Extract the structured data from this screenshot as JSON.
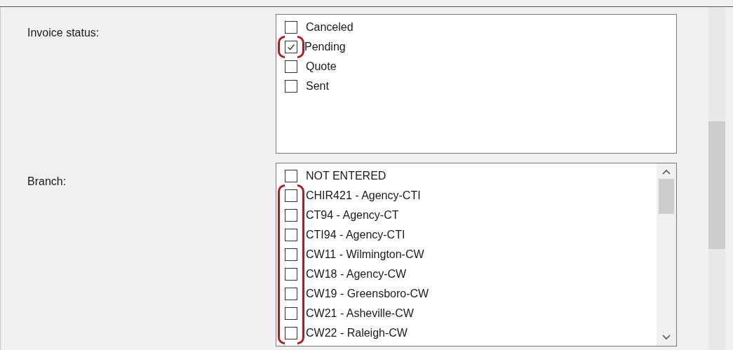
{
  "fields": [
    {
      "label": "Invoice status:",
      "kind": "plain",
      "options": [
        {
          "label": "Canceled",
          "checked": false,
          "circled": false
        },
        {
          "label": "Pending",
          "checked": true,
          "circled": true
        },
        {
          "label": "Quote",
          "checked": false,
          "circled": false
        },
        {
          "label": "Sent",
          "checked": false,
          "circled": false
        }
      ]
    },
    {
      "label": "Branch:",
      "kind": "scrolling",
      "options": [
        {
          "label": "NOT ENTERED",
          "checked": false,
          "circled": false
        },
        {
          "label": "CHIR421 - Agency-CTI",
          "checked": false,
          "circled": true
        },
        {
          "label": "CT94 - Agency-CT",
          "checked": false,
          "circled": true
        },
        {
          "label": "CTI94 - Agency-CTI",
          "checked": false,
          "circled": true
        },
        {
          "label": "CW11 - Wilmington-CW",
          "checked": false,
          "circled": true
        },
        {
          "label": "CW18 - Agency-CW",
          "checked": false,
          "circled": true
        },
        {
          "label": "CW19 - Greensboro-CW",
          "checked": false,
          "circled": true
        },
        {
          "label": "CW21 - Asheville-CW",
          "checked": false,
          "circled": true
        },
        {
          "label": "CW22 - Raleigh-CW",
          "checked": false,
          "circled": true
        }
      ]
    }
  ]
}
